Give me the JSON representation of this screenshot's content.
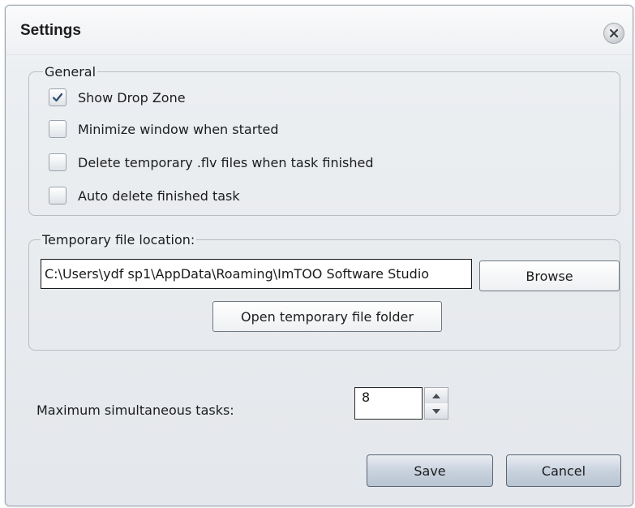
{
  "dialog": {
    "title": "Settings",
    "close_icon": "close-x-icon"
  },
  "general": {
    "legend": "General",
    "options": [
      {
        "label": "Show Drop Zone",
        "checked": true
      },
      {
        "label": "Minimize window when started",
        "checked": false
      },
      {
        "label": "Delete temporary .flv files when task finished",
        "checked": false
      },
      {
        "label": "Auto delete finished task",
        "checked": false
      }
    ]
  },
  "temp_location": {
    "legend": "Temporary file location:",
    "path_value": "C:\\Users\\ydf sp1\\AppData\\Roaming\\ImTOO Software Studio",
    "browse_label": "Browse",
    "open_folder_label": "Open temporary file folder"
  },
  "max_tasks": {
    "label": "Maximum simultaneous tasks:",
    "value": "8"
  },
  "footer": {
    "save_label": "Save",
    "cancel_label": "Cancel"
  },
  "colors": {
    "check_mark": "#2b4a6f",
    "primary_button_bottom": "#b8c4d1"
  }
}
